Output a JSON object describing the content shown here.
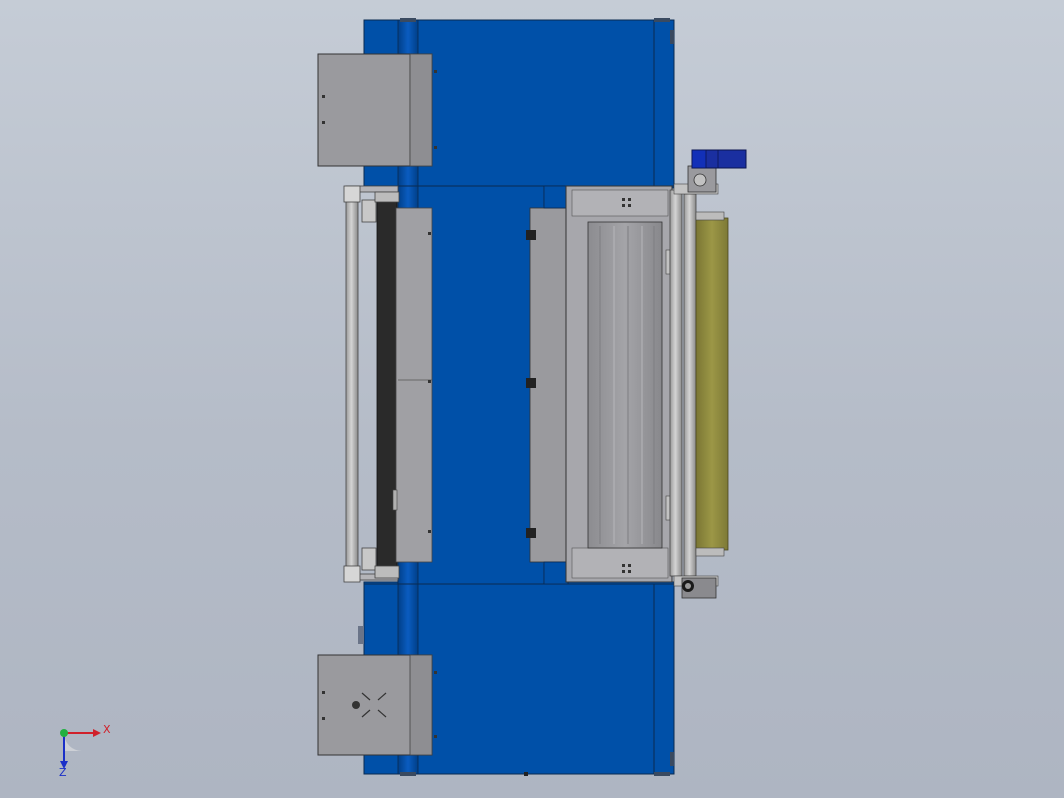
{
  "triad": {
    "x_label": "X",
    "z_label": "Z"
  },
  "colors": {
    "background_top": "#c5ccd6",
    "background_bottom": "#aeb5c2",
    "frame_blue": "#0050a8",
    "panel_gray": "#9a9a9e",
    "roller_light": "#c8c8c8",
    "belt_dark": "#2a2a2a",
    "felt_roll": "#8f8a3e",
    "motor_blue": "#1a2fa0",
    "axis_x": "#d0202a",
    "axis_y": "#20b040",
    "axis_z": "#1a2fc8"
  }
}
